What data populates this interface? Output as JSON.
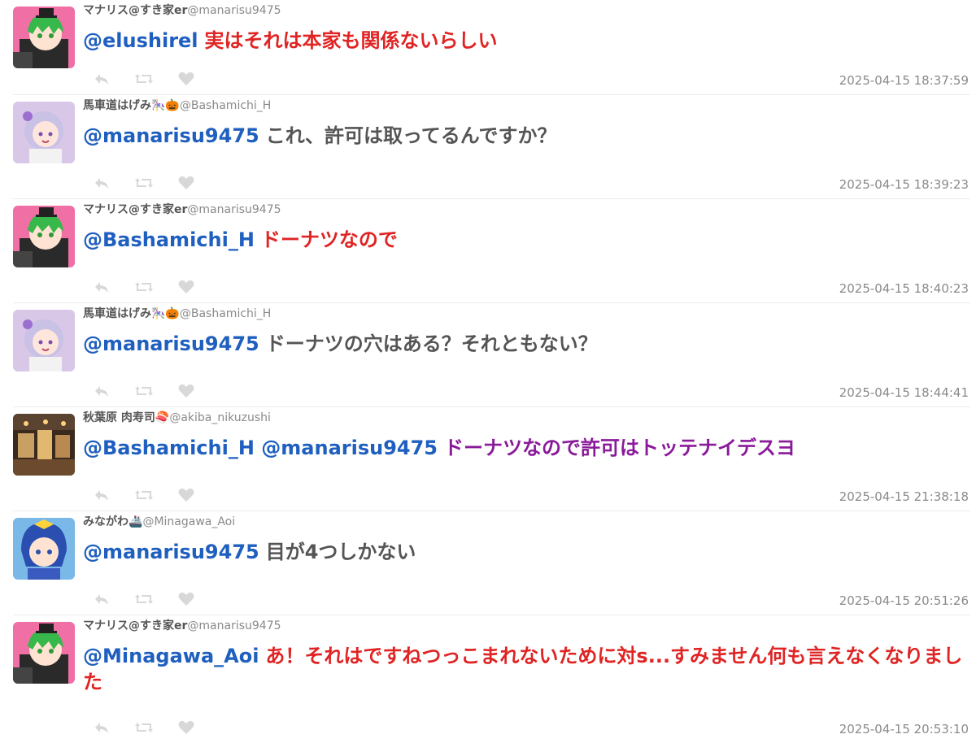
{
  "tweets": [
    {
      "name": "マナリス@すき家er",
      "handle": "@manarisu9475",
      "mention1": "@elushirel",
      "mention2": "",
      "text": "実はそれは本家も関係ないらしい",
      "text_color": "#e02424",
      "timestamp": "2025-04-15 18:37:59",
      "avatar": "avatar-manarisu"
    },
    {
      "name": "馬車道はげみ",
      "emoji": "🎠🎃",
      "handle": "@Bashamichi_H",
      "mention1": "@manarisu9475",
      "mention2": "",
      "text": "これ、許可は取ってるんですか？",
      "text_color": "#555555",
      "timestamp": "2025-04-15 18:39:23",
      "avatar": "avatar-bashamichi"
    },
    {
      "name": "マナリス@すき家er",
      "handle": "@manarisu9475",
      "mention1": "@Bashamichi_H",
      "mention2": "",
      "text": "ドーナツなので",
      "text_color": "#e02424",
      "timestamp": "2025-04-15 18:40:23",
      "avatar": "avatar-manarisu"
    },
    {
      "name": "馬車道はげみ",
      "emoji": "🎠🎃",
      "handle": "@Bashamichi_H",
      "mention1": "@manarisu9475",
      "mention2": "",
      "text": "ドーナツの穴はある？それともない？",
      "text_color": "#555555",
      "timestamp": "2025-04-15 18:44:41",
      "avatar": "avatar-bashamichi"
    },
    {
      "name": "秋葉原 肉寿司",
      "emoji": "🍣",
      "handle": "@akiba_nikuzushi",
      "mention1": "@Bashamichi_H",
      "mention2": "@manarisu9475",
      "text": "ドーナツなので許可はトッテナイデスヨ",
      "text_color": "#8a1a9a",
      "timestamp": "2025-04-15 21:38:18",
      "avatar": "avatar-akiba"
    },
    {
      "name": "みながわ",
      "emoji": "🚢",
      "handle": "@Minagawa_Aoi",
      "mention1": "@manarisu9475",
      "mention2": "",
      "text": "目が4つしかない",
      "text_color": "#555555",
      "timestamp": "2025-04-15 20:51:26",
      "avatar": "avatar-minagawa"
    },
    {
      "name": "マナリス@すき家er",
      "handle": "@manarisu9475",
      "mention1": "@Minagawa_Aoi",
      "mention2": "",
      "text": "あ！それはですねつっこまれないために対s...すみません何も言えなくなりました",
      "text_color": "#e02424",
      "timestamp": "2025-04-15 20:53:10",
      "avatar": "avatar-manarisu"
    }
  ],
  "icons": {
    "reply": "reply-icon",
    "retweet": "retweet-icon",
    "like": "like-icon"
  },
  "colors": {
    "mention": "#1f5fbf",
    "timestamp": "#8a8a8a",
    "icon": "#d8d8d8"
  }
}
